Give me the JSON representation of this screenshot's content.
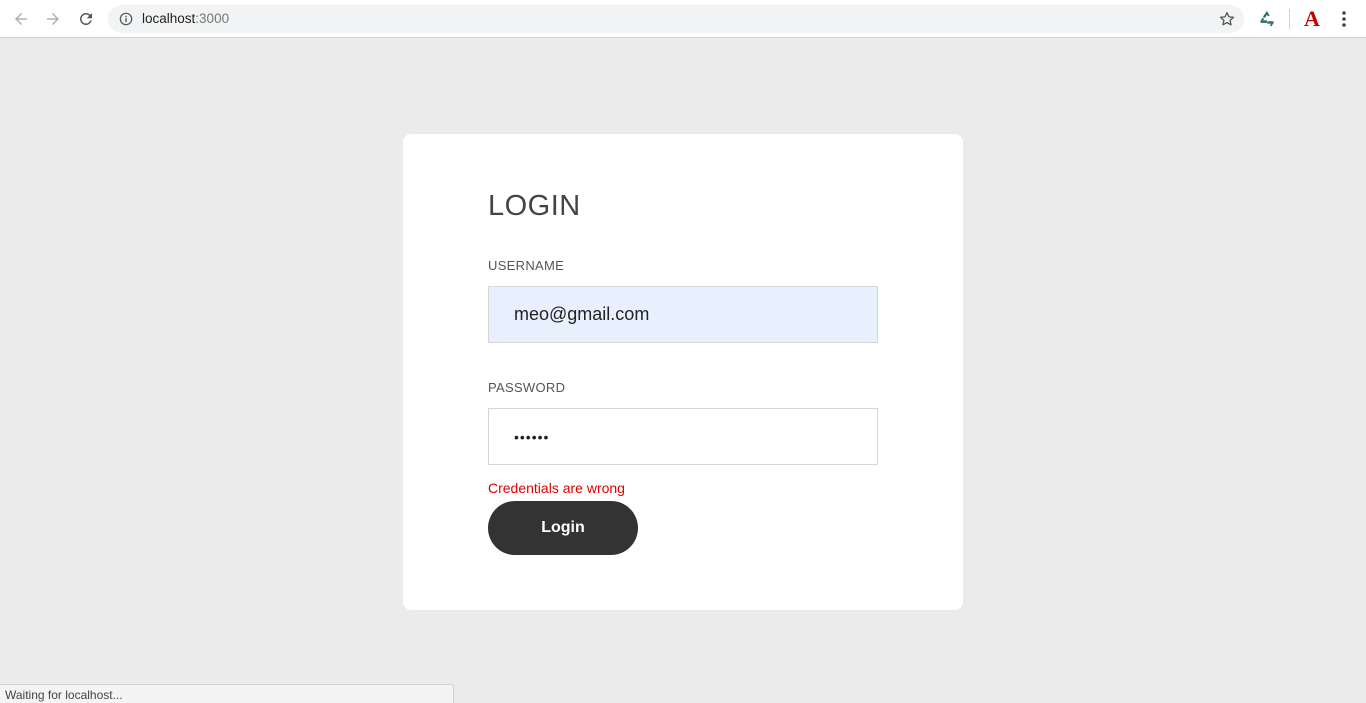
{
  "browser": {
    "url_host": "localhost",
    "url_port": ":3000",
    "icons": {
      "back": "back-arrow-icon",
      "forward": "forward-arrow-icon",
      "reload": "reload-icon",
      "info": "info-icon",
      "bookmark": "star-icon",
      "extension1": "recycle-icon",
      "extension2": "acrobat-icon",
      "menu": "kebab-menu-icon"
    },
    "acrobat_glyph": "A"
  },
  "login": {
    "title": "LOGIN",
    "username_label": "USERNAME",
    "username_value": "meo@gmail.com",
    "password_label": "PASSWORD",
    "password_value": "••••••",
    "error_text": "Credentials are wrong",
    "button_label": "Login"
  },
  "status_bar": {
    "text": "Waiting for localhost..."
  },
  "colors": {
    "page_background": "#ebebeb",
    "card_background": "#ffffff",
    "autofill_background": "#e8f0fe",
    "error": "#e00000",
    "button": "#333333"
  }
}
